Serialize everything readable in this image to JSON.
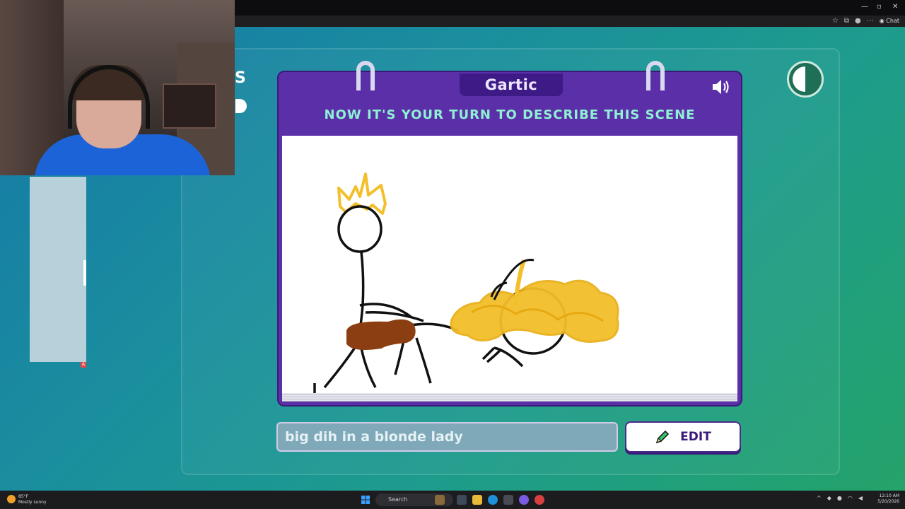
{
  "window": {
    "minimize": "—",
    "maximize": "▫",
    "close": "✕"
  },
  "browser": {
    "chat_label": "Chat"
  },
  "game": {
    "logo": "Gartic",
    "prompt_title": "NOW IT'S YOUR TURN TO DESCRIBE THIS SCENE",
    "answer_value": "big dih in a blonde lady",
    "edit_label": "EDIT",
    "left_cut_glyph": "S"
  },
  "taskbar": {
    "weather_temp": "85°F",
    "weather_desc": "Mostly sunny",
    "search_label": "Search",
    "time": "12:10 AM",
    "date": "5/20/2026"
  },
  "colors": {
    "card_purple": "#5b2fa8",
    "title_mint": "#8ff1d4",
    "crown_yellow": "#f3bf2a",
    "brown": "#8b3e12"
  }
}
